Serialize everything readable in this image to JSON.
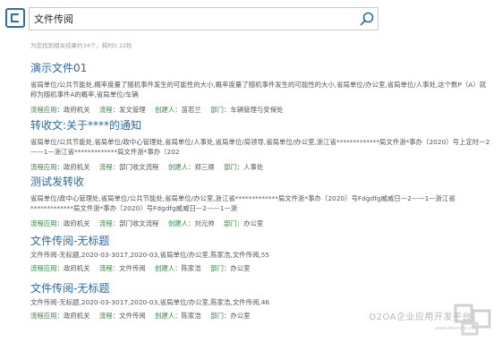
{
  "search": {
    "query": "文件传阅",
    "summary": "为您找到相关结果约34个，耗时0.22秒"
  },
  "meta_labels": {
    "app": "流程应用：",
    "process": "流程：",
    "creator": "创建人：",
    "dept": "部门："
  },
  "results": [
    {
      "title": "演示文件01",
      "snippet": "省局单位/公共节能处,概率度量了随机事件发生的可能性的大小,概率度量了随机事件发生的可能性的大小,省局单位/办公室,省局单位/人事处,这个数P（A）就称为随机事件A的概率,省局单位/车辆",
      "app": "政府机关",
      "process": "发文管理",
      "creator": "苗若兰",
      "dept": "车辆管理与安保处"
    },
    {
      "title": "转收文:关于****的通知",
      "snippet": "省局单位/公共节能处,省局单位/政中心管理处,省局单位/人事处,省局单位/局领导,省局单位/办公室,浙江省*************局文件浙*事办〔2020〕号上定时一2——1—浙江省*************局文件浙*事办〔202",
      "app": "政府机关",
      "process": "部门收文流程",
      "creator": "郑三顺",
      "dept": "人事处"
    },
    {
      "title": "测试发转收",
      "snippet": "省局单位/政中心管理处,省局单位/公共节能处,省局单位/办公室,浙江省*************局文件浙*事办〔2020〕号Fdgdfg威威日—2——1—浙江省*************局文件浙*事办〔2020〕号Fdgdfg威威日—2——1—浙",
      "app": "政府机关",
      "process": "部门收文流程",
      "creator": "刘元帅",
      "dept": "办公室"
    },
    {
      "title": "文件传阅-无标题",
      "snippet": "文件传阅-无标题,2020-03-3017,2020-03,省局单位/办公室,陈家浩,文件传阅,55",
      "app": "政府机关",
      "process": "文件传阅",
      "creator": "陈家浩",
      "dept": "办公室"
    },
    {
      "title": "文件传阅-无标题",
      "snippet": "文件传阅-无标题,2020-03-3017,2020-03,省局单位/办公室,陈家浩,文件传阅,46",
      "app": "政府机关",
      "process": "文件传阅",
      "creator": "陈家浩",
      "dept": "办公室"
    }
  ],
  "watermark": {
    "text": "O2OA企业应用开发平台",
    "url": "www.downxia.com"
  },
  "colors": {
    "accent": "#2a69b4",
    "meta_key": "#2e8a3d"
  },
  "icons": [
    "app-logo-icon",
    "search-icon"
  ]
}
